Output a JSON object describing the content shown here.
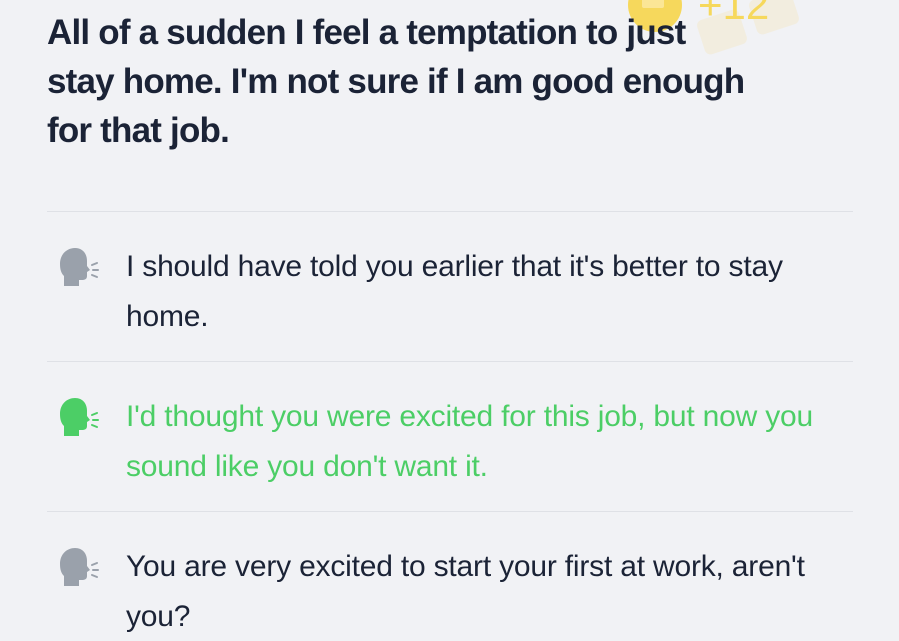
{
  "reward": {
    "points_text": "+12",
    "icon": "coin-crown-icon",
    "color": "#f6d85c"
  },
  "prompt": {
    "text": "All of a sudden I feel a temptation to just stay home. I'm not sure if I am good enough for that job."
  },
  "options": [
    {
      "label": "I should have told you earlier that it's better to stay home.",
      "icon": "speaking-head-icon",
      "state": "default",
      "color": "#9aa1ab"
    },
    {
      "label": "I'd thought you were excited for this job, but now you sound like you don't want it.",
      "icon": "speaking-head-icon",
      "state": "selected",
      "color": "#4cce66"
    },
    {
      "label": "You are very excited to start your first at work, aren't you?",
      "icon": "speaking-head-icon",
      "state": "default",
      "color": "#9aa1ab"
    }
  ],
  "colors": {
    "background": "#f1f2f5",
    "text": "#1b2336",
    "divider": "#dfe1e6",
    "selected": "#4cce66"
  }
}
